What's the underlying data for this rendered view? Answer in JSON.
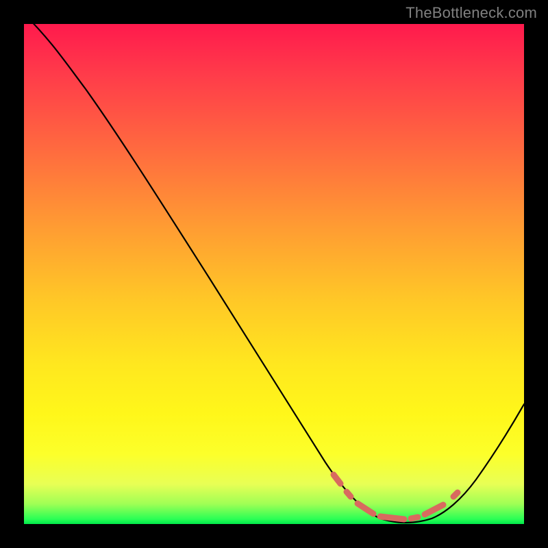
{
  "watermark": "TheBottleneck.com",
  "colors": {
    "background": "#000000",
    "curve": "#000000",
    "dash": "#d86a5f",
    "gradient_top": "#ff1a4d",
    "gradient_bottom": "#00e84a",
    "watermark": "#808080"
  },
  "chart_data": {
    "type": "line",
    "title": "",
    "xlabel": "",
    "ylabel": "",
    "xlim": [
      0,
      100
    ],
    "ylim": [
      0,
      100
    ],
    "grid": false,
    "legend": false,
    "annotations": [],
    "series": [
      {
        "name": "bottleneck-curve",
        "x": [
          0,
          5,
          10,
          15,
          20,
          25,
          30,
          35,
          40,
          45,
          50,
          55,
          60,
          65,
          68,
          71,
          74,
          77,
          80,
          83,
          86,
          90,
          94,
          97,
          100
        ],
        "values": [
          102,
          97,
          92,
          86,
          79,
          72,
          64,
          56,
          48,
          40,
          32,
          24,
          17,
          10,
          6,
          3,
          1,
          0.5,
          1,
          2,
          4,
          8,
          14,
          20,
          26
        ]
      }
    ],
    "highlight_region": {
      "name": "optimal-zone-dashes",
      "x_start": 62,
      "x_end": 86,
      "style": "dashed",
      "color": "#d86a5f"
    }
  }
}
